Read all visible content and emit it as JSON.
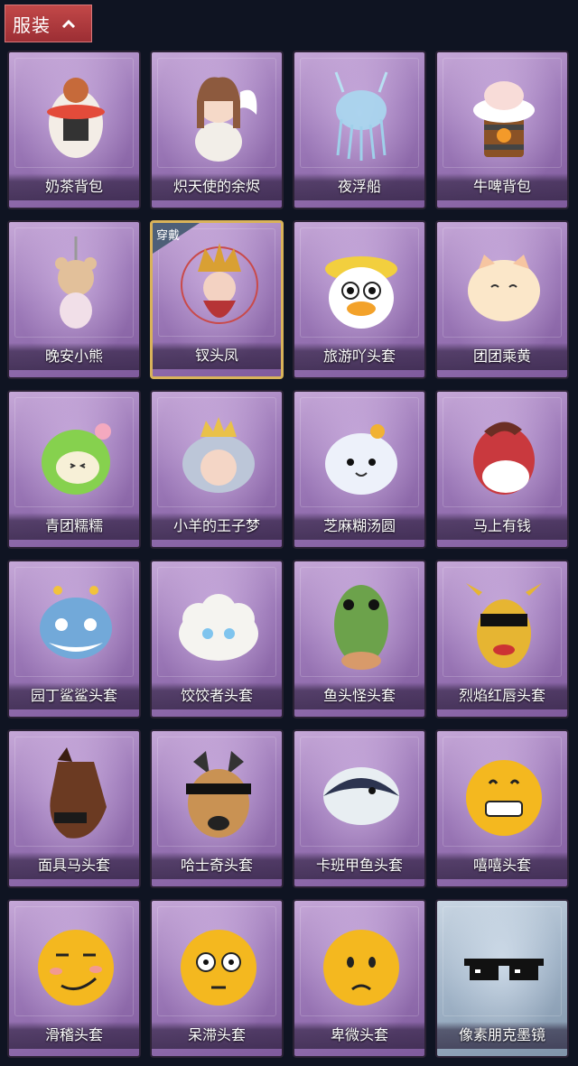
{
  "header": {
    "tab_label": "服装"
  },
  "items": [
    {
      "label": "奶茶背包",
      "icon": "milk-tea-backpack-icon"
    },
    {
      "label": "炽天使的余烬",
      "icon": "angel-doll-icon"
    },
    {
      "label": "夜浮船",
      "icon": "jellyfish-icon"
    },
    {
      "label": "牛啤背包",
      "icon": "cow-beer-backpack-icon"
    },
    {
      "label": "晚安小熊",
      "icon": "bear-charm-icon"
    },
    {
      "label": "钗头凤",
      "icon": "phoenix-crown-doll-icon",
      "badge": "穿戴",
      "equipped": true
    },
    {
      "label": "旅游吖头套",
      "icon": "tourist-duck-head-icon"
    },
    {
      "label": "团团乘黄",
      "icon": "fluffy-cat-head-icon"
    },
    {
      "label": "青团糯糯",
      "icon": "green-rice-ball-head-icon"
    },
    {
      "label": "小羊的王子梦",
      "icon": "sheep-prince-head-icon"
    },
    {
      "label": "芝麻糊汤圆",
      "icon": "dumpling-head-icon"
    },
    {
      "label": "马上有钱",
      "icon": "red-horse-head-icon"
    },
    {
      "label": "园丁鲨鲨头套",
      "icon": "shark-head-icon"
    },
    {
      "label": "饺饺者头套",
      "icon": "cloud-dumpling-head-icon"
    },
    {
      "label": "鱼头怪头套",
      "icon": "fish-monster-head-icon"
    },
    {
      "label": "烈焰红唇头套",
      "icon": "yellow-mask-sunglasses-icon"
    },
    {
      "label": "面具马头套",
      "icon": "horse-mask-icon"
    },
    {
      "label": "哈士奇头套",
      "icon": "husky-head-icon"
    },
    {
      "label": "卡班甲鱼头套",
      "icon": "fish-head-icon"
    },
    {
      "label": "嘻嘻头套",
      "icon": "grin-emoji-head-icon"
    },
    {
      "label": "滑稽头套",
      "icon": "smirk-emoji-head-icon"
    },
    {
      "label": "呆滞头套",
      "icon": "stare-emoji-head-icon"
    },
    {
      "label": "卑微头套",
      "icon": "humble-emoji-head-icon"
    },
    {
      "label": "像素朋克墨镜",
      "icon": "pixel-sunglasses-icon",
      "style": "pixel"
    }
  ],
  "colors": {
    "background": "#0f1422",
    "card": "#9c79b8",
    "tab": "#b03a3e",
    "equipped_border": "#d9b35a"
  }
}
